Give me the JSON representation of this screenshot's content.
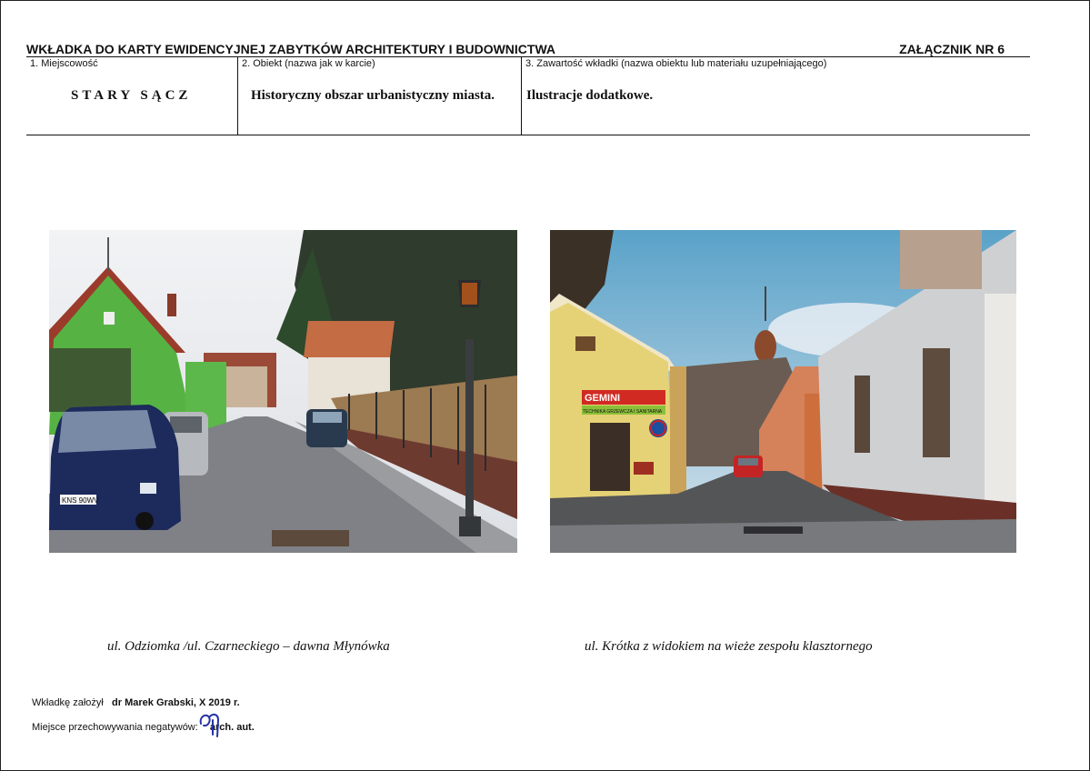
{
  "header": {
    "title": "WKŁADKA DO KARTY EWIDENCYJNEJ ZABYTKÓW ARCHITEKTURY I BUDOWNICTWA",
    "annex": "ZAŁĄCZNIK NR 6"
  },
  "fields": {
    "f1_label": "1. Miejscowość",
    "f1_value": "STARY SĄCZ",
    "f2_label": "2. Obiekt (nazwa jak w karcie)",
    "f2_value": "Historyczny obszar urbanistyczny miasta.",
    "f3_label": "3. Zawartość wkładki (nazwa obiektu lub materiału uzupełniającego)",
    "f3_value": "Ilustracje dodatkowe."
  },
  "photos": {
    "left": {
      "caption": "ul. Odziomka /ul. Czarneckiego – dawna Młynówka",
      "plate": "KNS 90WV"
    },
    "right": {
      "caption": "ul. Krótka z widokiem na wieże zespołu klasztornego",
      "sign_1": "GEMINI",
      "sign_2": "TECHNIKA GRZEWCZA I SANITARNA"
    }
  },
  "footer": {
    "author_label": "Wkładkę założył",
    "author_value": "dr Marek Grabski, X 2019 r.",
    "storage_label": "Miejsce przechowywania negatywów:",
    "storage_value": "arch. aut."
  }
}
